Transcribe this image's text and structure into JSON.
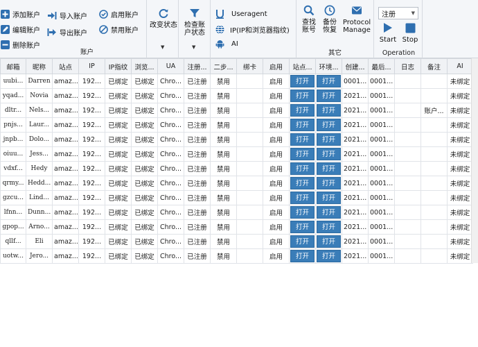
{
  "ribbon": {
    "account": {
      "add": "添加账户",
      "edit": "编辑账户",
      "delete": "删除账户",
      "import": "导入账户",
      "export": "导出账户",
      "enable": "启用账户",
      "disable": "禁用账户",
      "label": "账户"
    },
    "change_status": "改变状态",
    "check_status": "检查账\n户状态",
    "ua": {
      "useragent": "Useragent",
      "ip": "IP(IP和浏览器指纹)",
      "ai": "AI"
    },
    "other": {
      "search": "查找\n账号",
      "backup": "备份\n恢复",
      "protocol": "Protocol\nManage",
      "label": "其它"
    },
    "operation": {
      "select_value": "注册",
      "start": "Start",
      "stop": "Stop",
      "label": "Operation"
    }
  },
  "grid": {
    "columns": [
      "邮箱",
      "昵称",
      "站点",
      "IP",
      "IP指纹",
      "浏览...",
      "UA",
      "注册...",
      "二步...",
      "绑卡",
      "启用",
      "站点...",
      "环境...",
      "创建...",
      "最后...",
      "日志",
      "备注",
      "AI"
    ],
    "rows": [
      [
        "uubi...",
        "Darren",
        "amaz...",
        "192...",
        "已绑定",
        "已绑定",
        "Chro...",
        "已注册",
        "禁用",
        "",
        "启用",
        "打开",
        "打开",
        "0001...",
        "0001...",
        "",
        "",
        "未绑定"
      ],
      [
        "yqad...",
        "Novia",
        "amaz...",
        "192...",
        "已绑定",
        "已绑定",
        "Chro...",
        "已注册",
        "禁用",
        "",
        "启用",
        "打开",
        "打开",
        "2021...",
        "0001...",
        "",
        "",
        "未绑定"
      ],
      [
        "dltr...",
        "Nels...",
        "amaz...",
        "192...",
        "已绑定",
        "已绑定",
        "Chro...",
        "已注册",
        "禁用",
        "",
        "启用",
        "打开",
        "打开",
        "2021...",
        "0001...",
        "",
        "账户...",
        "未绑定"
      ],
      [
        "pnjs...",
        "Laur...",
        "amaz...",
        "192...",
        "已绑定",
        "已绑定",
        "Chro...",
        "已注册",
        "禁用",
        "",
        "启用",
        "打开",
        "打开",
        "2021...",
        "0001...",
        "",
        "",
        "未绑定"
      ],
      [
        "jnpb...",
        "Dolo...",
        "amaz...",
        "192...",
        "已绑定",
        "已绑定",
        "Chro...",
        "已注册",
        "禁用",
        "",
        "启用",
        "打开",
        "打开",
        "2021...",
        "0001...",
        "",
        "",
        "未绑定"
      ],
      [
        "oiuu...",
        "Jess...",
        "amaz...",
        "192...",
        "已绑定",
        "已绑定",
        "Chro...",
        "已注册",
        "禁用",
        "",
        "启用",
        "打开",
        "打开",
        "2021...",
        "0001...",
        "",
        "",
        "未绑定"
      ],
      [
        "vdxf...",
        "Hedy",
        "amaz...",
        "192...",
        "已绑定",
        "已绑定",
        "Chro...",
        "已注册",
        "禁用",
        "",
        "启用",
        "打开",
        "打开",
        "2021...",
        "0001...",
        "",
        "",
        "未绑定"
      ],
      [
        "qrmy...",
        "Hedd...",
        "amaz...",
        "192...",
        "已绑定",
        "已绑定",
        "Chro...",
        "已注册",
        "禁用",
        "",
        "启用",
        "打开",
        "打开",
        "2021...",
        "0001...",
        "",
        "",
        "未绑定"
      ],
      [
        "gzcu...",
        "Lind...",
        "amaz...",
        "192...",
        "已绑定",
        "已绑定",
        "Chro...",
        "已注册",
        "禁用",
        "",
        "启用",
        "打开",
        "打开",
        "2021...",
        "0001...",
        "",
        "",
        "未绑定"
      ],
      [
        "lfnn...",
        "Dunn...",
        "amaz...",
        "192...",
        "已绑定",
        "已绑定",
        "Chro...",
        "已注册",
        "禁用",
        "",
        "启用",
        "打开",
        "打开",
        "2021...",
        "0001...",
        "",
        "",
        "未绑定"
      ],
      [
        "gpop...",
        "Arno...",
        "amaz...",
        "192...",
        "已绑定",
        "已绑定",
        "Chro...",
        "已注册",
        "禁用",
        "",
        "启用",
        "打开",
        "打开",
        "2021...",
        "0001...",
        "",
        "",
        "未绑定"
      ],
      [
        "qllf...",
        "Eli",
        "amaz...",
        "192...",
        "已绑定",
        "已绑定",
        "Chro...",
        "已注册",
        "禁用",
        "",
        "启用",
        "打开",
        "打开",
        "2021...",
        "0001...",
        "",
        "",
        "未绑定"
      ],
      [
        "uotw...",
        "Jero...",
        "amaz...",
        "192...",
        "已绑定",
        "已绑定",
        "Chro...",
        "已注册",
        "禁用",
        "",
        "启用",
        "打开",
        "打开",
        "2021...",
        "0001...",
        "",
        "",
        "未绑定"
      ]
    ]
  },
  "colors": {
    "open_button": "#3a7db8",
    "icon_blue": "#2f6fb0"
  }
}
